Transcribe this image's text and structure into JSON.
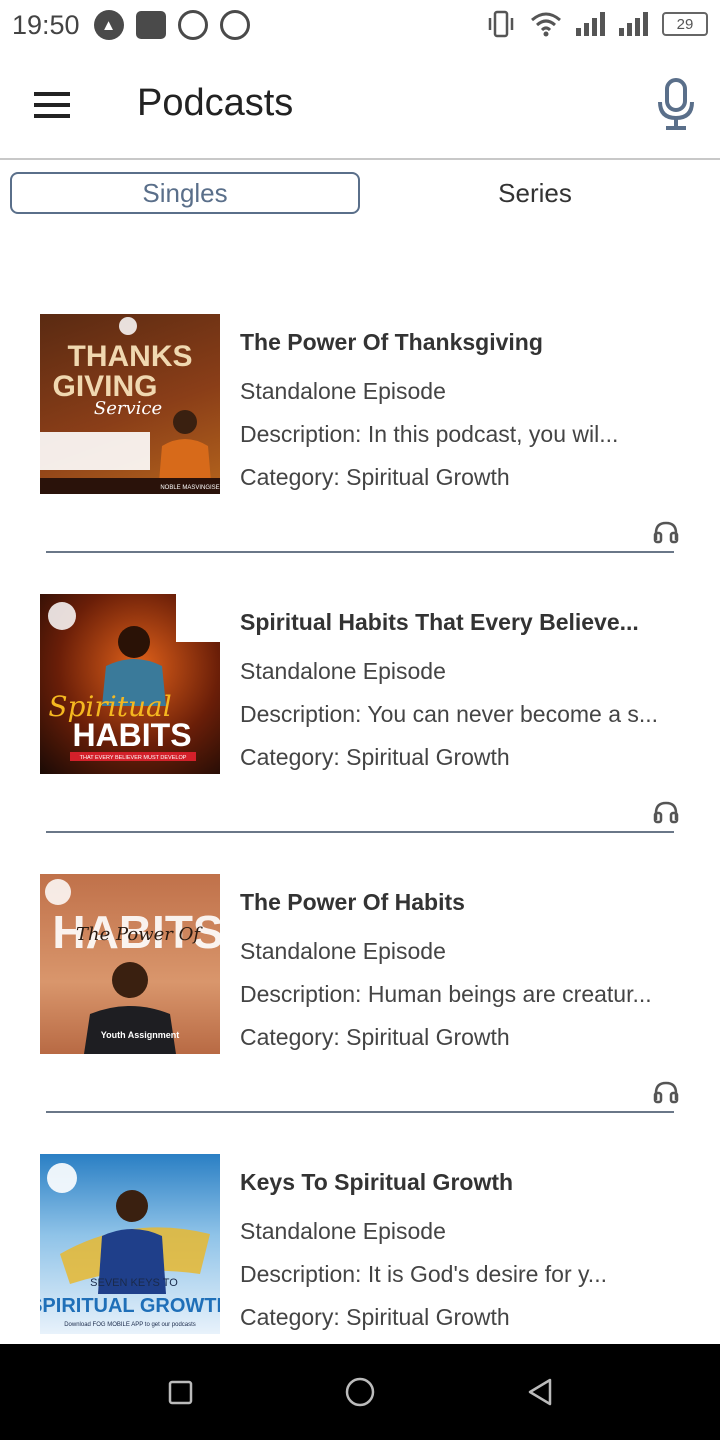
{
  "status_bar": {
    "time": "19:50",
    "left_icons": [
      "navigation-icon",
      "activity-icon",
      "whatsapp-icon",
      "whatsapp-icon"
    ],
    "right_icons": [
      "vibrate-icon",
      "wifi-icon",
      "signal-icon",
      "signal-icon"
    ],
    "battery": "29"
  },
  "app_bar": {
    "title": "Podcasts",
    "menu_icon": "hamburger-icon",
    "action_icon": "microphone-icon"
  },
  "tabs": {
    "singles": "Singles",
    "series": "Series",
    "selected": "Singles"
  },
  "episodes": [
    {
      "title": "The Power Of Thanksgiving",
      "type": "Standalone Episode",
      "description": "Description: In this podcast, you wil...",
      "category": "Category: Spiritual Growth",
      "thumb_lines": [
        "THANKS",
        "GIVING",
        "Service"
      ],
      "thumb_footer": "NOBLE MASVINGISE",
      "thumb_colors": [
        "#5a2a12",
        "#b5651d"
      ]
    },
    {
      "title": "Spiritual Habits That Every Believe...",
      "type": "Standalone Episode",
      "description": "Description: You can never become a s...",
      "category": "Category: Spiritual Growth",
      "thumb_lines": [
        "Spiritual",
        "HABITS"
      ],
      "thumb_footer": "THAT EVERY BELIEVER MUST DEVELOP",
      "thumb_colors": [
        "#1a0a05",
        "#e0611a"
      ]
    },
    {
      "title": "The Power Of Habits",
      "type": "Standalone Episode",
      "description": "Description: Human beings are creatur...",
      "category": "Category: Spiritual Growth",
      "thumb_lines": [
        "HABITS",
        "The Power Of"
      ],
      "thumb_footer": "Youth Assignment",
      "thumb_colors": [
        "#c0714a",
        "#d9966c"
      ]
    },
    {
      "title": "Keys To Spiritual Growth",
      "type": "Standalone Episode",
      "description": "Description: It is God's desire for y...",
      "category": "Category: Spiritual Growth",
      "thumb_lines": [
        "SEVEN KEYS TO",
        "SPIRITUAL GROWTH"
      ],
      "thumb_footer": "Download FOG MOBILE APP to get our podcasts",
      "thumb_colors": [
        "#2a7fc4",
        "#e8f2fb"
      ]
    }
  ],
  "nav_bar": {
    "buttons": [
      "recents-icon",
      "home-icon",
      "back-icon"
    ]
  }
}
